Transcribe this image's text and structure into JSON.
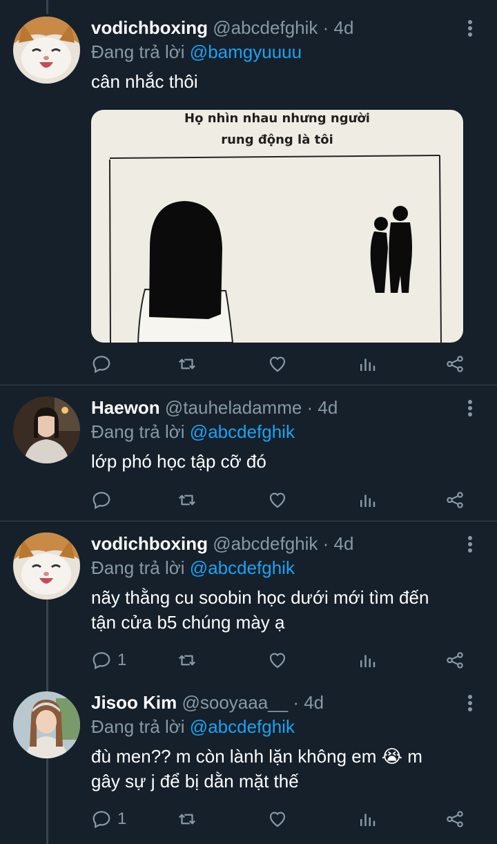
{
  "colors": {
    "background": "#15202b",
    "secondary": "#8899a6",
    "mention": "#1da1f2",
    "divider": "#38444d"
  },
  "tweets": [
    {
      "name": "vodichboxing",
      "handle": "@abcdefghik",
      "time": "· 4d",
      "reply_prefix": "Đang trả lời",
      "reply_to": "@bamgyuuuu",
      "text": "cân nhắc thôi",
      "media_caption_1": "Họ nhìn nhau nhưng người",
      "media_caption_2": "rung động là tôi",
      "reply_count": ""
    },
    {
      "name": "Haewon",
      "handle": "@tauheladamme",
      "time": "· 4d",
      "reply_prefix": "Đang trả lời",
      "reply_to": "@abcdefghik",
      "text": "lớp phó học tập cỡ đó",
      "reply_count": ""
    },
    {
      "name": "vodichboxing",
      "handle": "@abcdefghik",
      "time": "· 4d",
      "reply_prefix": "Đang trả lời",
      "reply_to": "@abcdefghik",
      "text_line1": "nãy thằng cu soobin học dưới mới tìm đến",
      "text_line2": "tận cửa b5 chúng mày ạ",
      "reply_count": "1"
    },
    {
      "name": "Jisoo Kim",
      "handle": "@sooyaaa__",
      "time": "· 4d",
      "reply_prefix": "Đang trả lời",
      "reply_to": "@abcdefghik",
      "text_line1": "đù men?? m còn lành lặn không em 😭 m",
      "text_line2": "gây sự j để bị dằn mặt thế",
      "reply_count": "1"
    }
  ]
}
